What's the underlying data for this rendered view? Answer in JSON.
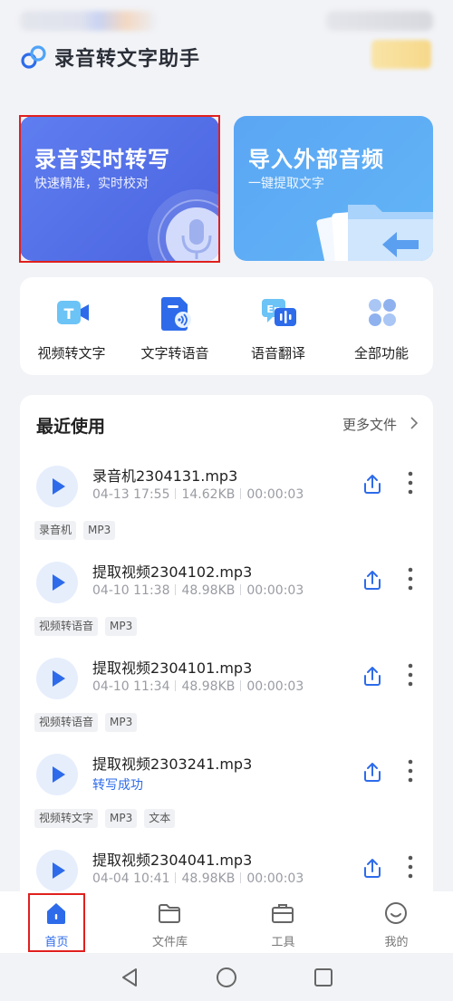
{
  "app": {
    "title": "录音转文字助手"
  },
  "feature_cards": [
    {
      "title": "录音实时转写",
      "subtitle": "快速精准，实时校对",
      "icon": "microphone-icon"
    },
    {
      "title": "导入外部音频",
      "subtitle": "一键提取文字",
      "icon": "folder-import-icon"
    }
  ],
  "quick_actions": [
    {
      "label": "视频转文字",
      "icon": "video-to-text-icon"
    },
    {
      "label": "文字转语音",
      "icon": "text-to-speech-icon"
    },
    {
      "label": "语音翻译",
      "icon": "voice-translate-icon"
    },
    {
      "label": "全部功能",
      "icon": "all-features-icon"
    }
  ],
  "recent": {
    "title": "最近使用",
    "more_label": "更多文件",
    "files": [
      {
        "name": "录音机2304131.mp3",
        "date": "04-13 17:55",
        "size": "14.62KB",
        "duration": "00:00:03",
        "status": "",
        "tags": [
          "录音机",
          "MP3"
        ]
      },
      {
        "name": "提取视频2304102.mp3",
        "date": "04-10 11:38",
        "size": "48.98KB",
        "duration": "00:00:03",
        "status": "",
        "tags": [
          "视频转语音",
          "MP3"
        ]
      },
      {
        "name": "提取视频2304101.mp3",
        "date": "04-10 11:34",
        "size": "48.98KB",
        "duration": "00:00:03",
        "status": "",
        "tags": [
          "视频转语音",
          "MP3"
        ]
      },
      {
        "name": "提取视频2303241.mp3",
        "date": "",
        "size": "",
        "duration": "",
        "status": "转写成功",
        "tags": [
          "视频转文字",
          "MP3",
          "文本"
        ]
      },
      {
        "name": "提取视频2304041.mp3",
        "date": "04-04 10:41",
        "size": "48.98KB",
        "duration": "00:00:03",
        "status": "",
        "tags": []
      }
    ]
  },
  "bottom_nav": [
    {
      "label": "首页",
      "icon": "home-icon",
      "active": true
    },
    {
      "label": "文件库",
      "icon": "folder-icon",
      "active": false
    },
    {
      "label": "工具",
      "icon": "toolbox-icon",
      "active": false
    },
    {
      "label": "我的",
      "icon": "profile-icon",
      "active": false
    }
  ],
  "colors": {
    "accent": "#2d6bea",
    "record_card": "#4a63df",
    "import_card": "#5ba6f4",
    "highlight_border": "#e0201e"
  }
}
